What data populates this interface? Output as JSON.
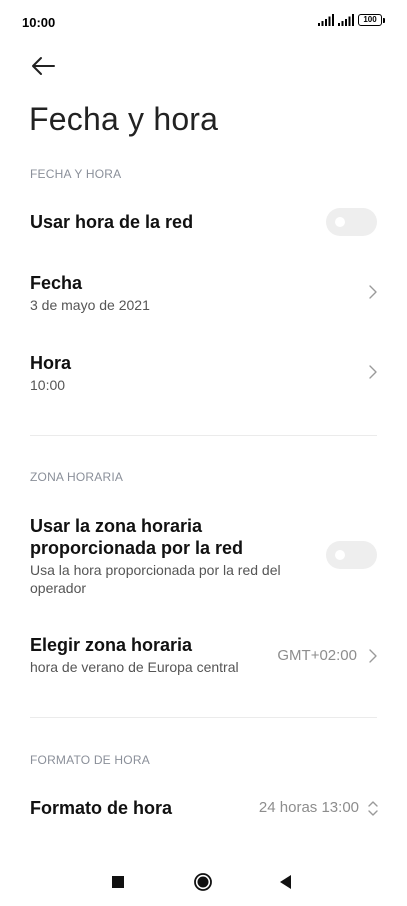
{
  "status_bar": {
    "time": "10:00",
    "battery": "100"
  },
  "header": {
    "back_icon": "arrow-left-icon",
    "title": "Fecha y hora"
  },
  "sections": {
    "date_time": {
      "header": "FECHA Y HORA",
      "use_network_time": {
        "label": "Usar hora de la red",
        "enabled": false
      },
      "date": {
        "label": "Fecha",
        "value": "3 de mayo de 2021"
      },
      "time": {
        "label": "Hora",
        "value": "10:00"
      }
    },
    "time_zone": {
      "header": "ZONA HORARIA",
      "use_network_zone": {
        "label_line1": "Usar la zona horaria",
        "label_line2": "proporcionada por la red",
        "sub_line1": "Usa la hora proporcionada por la red del",
        "sub_line2": "operador",
        "enabled": false
      },
      "choose_zone": {
        "label": "Elegir zona horaria",
        "sub": "hora de verano de Europa central",
        "value": "GMT+02:00"
      }
    },
    "time_format": {
      "header": "FORMATO DE HORA",
      "format": {
        "label": "Formato de hora",
        "value": "24 horas 13:00"
      }
    }
  },
  "nav_bar": {
    "recents_icon": "square-icon",
    "home_icon": "circle-icon",
    "back_icon": "triangle-back-icon"
  },
  "colors": {
    "section_header": "#8a8f99",
    "toggle_off": "#eeeeee",
    "divider": "#ebebeb"
  }
}
